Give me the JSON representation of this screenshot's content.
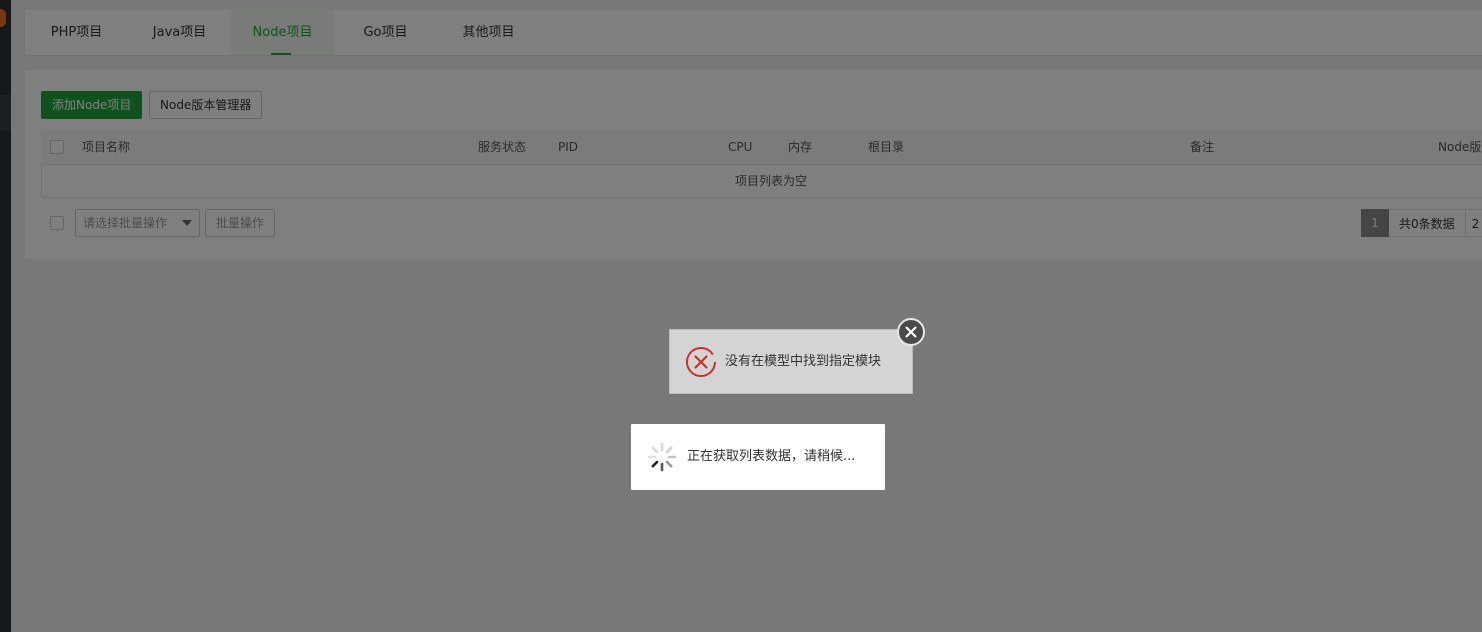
{
  "tabs": [
    {
      "label": "PHP项目",
      "active": false
    },
    {
      "label": "Java项目",
      "active": false
    },
    {
      "label": "Node项目",
      "active": true
    },
    {
      "label": "Go项目",
      "active": false
    },
    {
      "label": "其他项目",
      "active": false
    }
  ],
  "toolbar": {
    "add_label": "添加Node项目",
    "version_manager_label": "Node版本管理器"
  },
  "table": {
    "columns": [
      "项目名称",
      "服务状态",
      "PID",
      "CPU",
      "内存",
      "根目录",
      "备注",
      "Node版"
    ],
    "empty_text": "项目列表为空"
  },
  "batch": {
    "select_placeholder": "请选择批量操作",
    "action_label": "批量操作"
  },
  "pager": {
    "current_page": "1",
    "total_text": "共0条数据",
    "more": "2"
  },
  "error_toast": {
    "message": "没有在模型中找到指定模块"
  },
  "loading": {
    "message": "正在获取列表数据，请稍候..."
  },
  "colors": {
    "accent": "#20a53a",
    "error": "#c9302c",
    "overlay": "rgba(0,0,0,0.5)"
  }
}
